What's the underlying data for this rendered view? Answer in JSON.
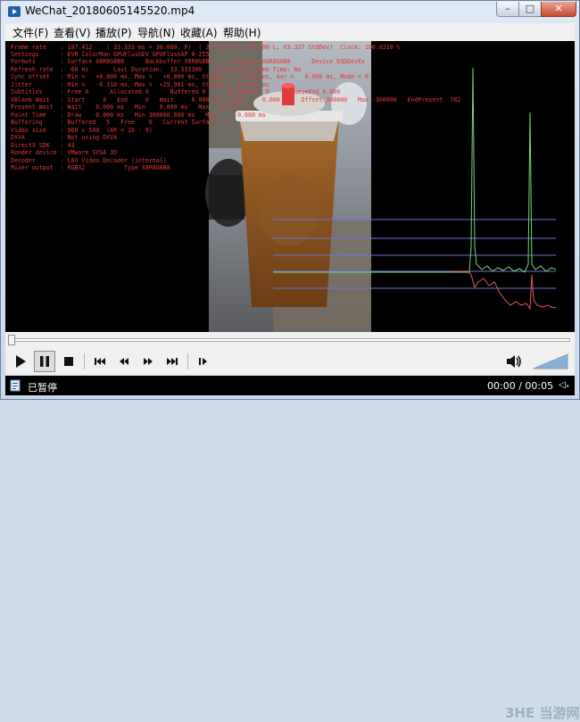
{
  "window": {
    "title": "WeChat_20180605145520.mp4",
    "controls": {
      "minimize": "–",
      "maximize": "□",
      "close": "✕"
    }
  },
  "menu": {
    "items": [
      "文件(F)",
      "查看(V)",
      "播放(P)",
      "导航(N)",
      "收藏(A)",
      "帮助(H)"
    ]
  },
  "stats": {
    "lines": [
      "Frame rate    : 107.412    ( 33.333 ms = 30.000, P)  ( 33.333 ms = 30.000 L, 63.337 StdDev)  Clock: 100.0210 %",
      "Settings      : EVR ColorMan GPUFlushEV GPUFlushAP 0-255",
      "Formats       : Surface X8R8G8B8      Backbuffer X8R8G8B8      Display A8R8G8B8      Device D3DDevEx",
      "Refresh rate  :  60 Hz       Last Duration:  33.333300    Corrected Frame Time: No",
      "Sync offset   : Min =   +0.000 ms, Max =   +0.000 ms, StdDev =   0.000 ms, Avr =   0.000 ms, Mode = 0",
      "Jitter        : Min =   -0.310 ms, Max =  +29.901 ms, StdDev =  12.332 ms",
      "Subtitles     : Free 0      Allocated 0      Buffered 0      QueueStart 0      QueueEnd 0.000",
      "VBlank Wait   : Start     0   End     0   Wait     0.000 ms   Lock     0.000 ms   Offset 300000   Max -300000   EndPresent  782",
      "Present Wait  : Wait    0.000 ms   Min    0.000 ms   Max   60.477 ms",
      "Paint Time    : Draw    0.000 ms   Min 300000.000 ms   Max      0.000 ms",
      "Buffering     : Buffered   5   Free    0   Current Surface   1",
      "Video size    : 960 x 540  (AR = 16 : 9)",
      "DXVA          : Not using DXVA",
      "DirectX SDK   : 43",
      "Render device : VMware SVGA 3D",
      "Decoder       : LAV Video Decoder (internal)",
      "Mixer output  : RGB32           Type X8R8G8B8"
    ]
  },
  "graph": {
    "line_colors": {
      "green": "#7cd27c",
      "red": "#e05a5a",
      "blue": "#6a72d8"
    }
  },
  "playback": {
    "status": "已暂停",
    "elapsed": "00:00",
    "total": "00:05",
    "time_separator": " / ",
    "volume_short": "◁ₓ",
    "position": 0.0
  },
  "watermark": "3HE 当游网"
}
